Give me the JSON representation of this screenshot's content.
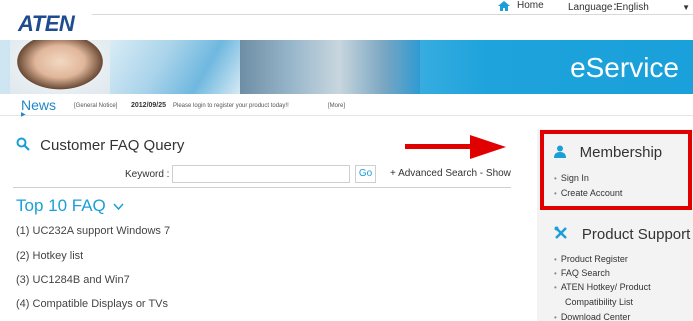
{
  "header": {
    "logo": "ATEN",
    "home_label": "Home",
    "language_label": "Language：",
    "language_value": "English"
  },
  "banner": {
    "title": "eService"
  },
  "news": {
    "title": "News",
    "type": "[General Notice]",
    "date": "2012/09/25",
    "text": "Please login to register your product today!!",
    "more": "[More]"
  },
  "faq_query": {
    "title": "Customer FAQ Query",
    "keyword_label": "Keyword :",
    "keyword_value": "",
    "go_label": "Go",
    "advanced_label": "+ Advanced Search - Show"
  },
  "top10": {
    "title": "Top 10 FAQ",
    "items": [
      "(1) UC232A support Windows 7",
      "(2) Hotkey list",
      "(3) UC1284B and Win7",
      "(4) Compatible Displays or TVs"
    ]
  },
  "membership": {
    "title": "Membership",
    "links": [
      "Sign In",
      "Create Account"
    ]
  },
  "product_support": {
    "title": "Product Support",
    "links": [
      "Product Register",
      "FAQ Search",
      "ATEN Hotkey/ Product",
      "Compatibility List",
      "Download Center"
    ]
  },
  "colors": {
    "accent": "#1a9fd8",
    "highlight_red": "#e10000",
    "logo_blue": "#1e4c8f"
  },
  "icons": {
    "home": "home-icon",
    "search": "search-icon",
    "user": "user-icon",
    "tools": "tools-icon"
  }
}
